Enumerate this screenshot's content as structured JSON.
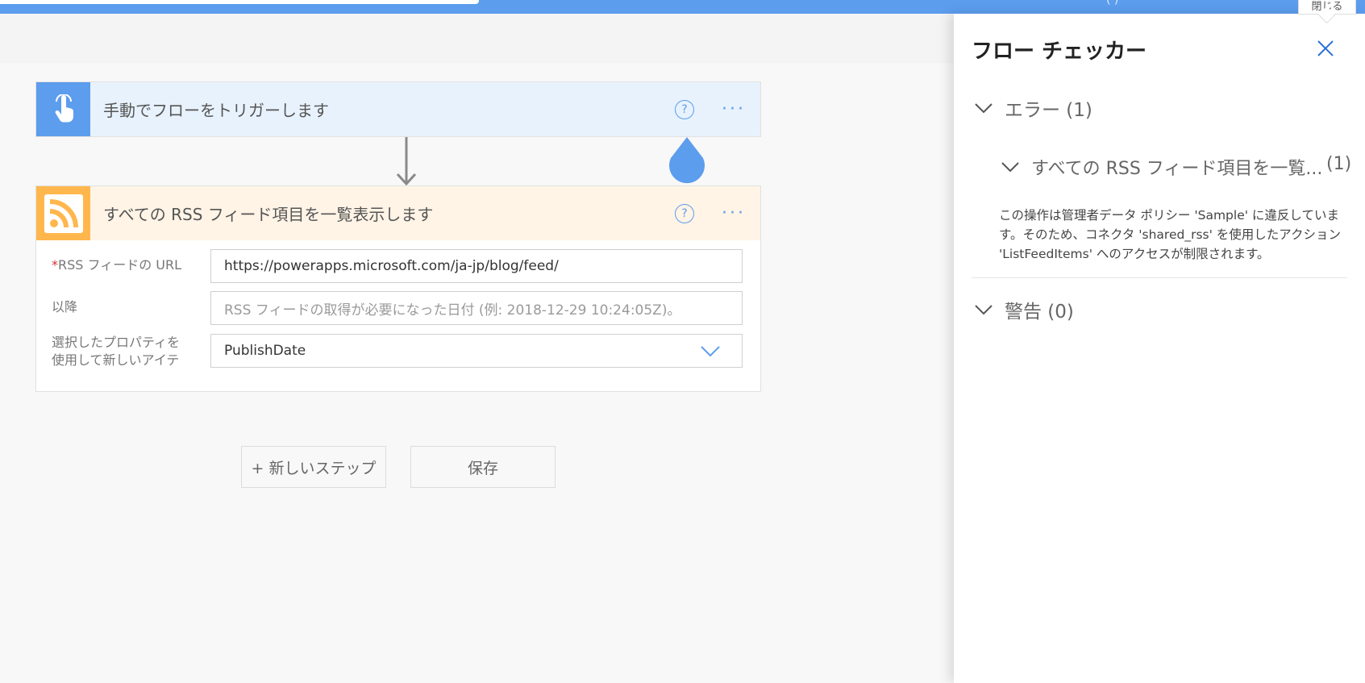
{
  "topbar": {
    "partial_text": "(   )"
  },
  "trigger_card": {
    "title": "手動でフローをトリガーします",
    "icon": "touch-hand-icon",
    "help": "?"
  },
  "rss_card": {
    "title": "すべての RSS フィード項目を一覧表示します",
    "icon": "rss-icon",
    "help": "?",
    "fields": {
      "url_label_required": "*",
      "url_label": "RSS フィードの URL",
      "url_value": "https://powerapps.microsoft.com/ja-jp/blog/feed/",
      "since_label": "以降",
      "since_placeholder": "RSS フィードの取得が必要になった日付 (例: 2018-12-29 10:24:05Z)。",
      "property_label_line1": "選択したプロパティを",
      "property_label_line2": "使用して新しいアイテ",
      "property_value": "PublishDate"
    }
  },
  "actions": {
    "new_step": "+ 新しいステップ",
    "save": "保存"
  },
  "flow_checker": {
    "title": "フロー チェッカー",
    "close_tooltip": "閉じる",
    "errors_label": "エラー (1)",
    "error_item_label": "すべての RSS フィード項目を一覧...",
    "error_item_count": "(1)",
    "error_description": "この操作は管理者データ ポリシー 'Sample' に違反しています。そのため、コネクタ 'shared_rss' を使用したアクション 'ListFeedItems' へのアクセスが制限されます。",
    "warnings_label": "警告 (0)"
  },
  "colors": {
    "accent": "#5c9ded",
    "trigger_bg": "#e8f2fd",
    "rss_icon_bg": "#ffb74d",
    "rss_header_bg": "#fff4e6"
  }
}
